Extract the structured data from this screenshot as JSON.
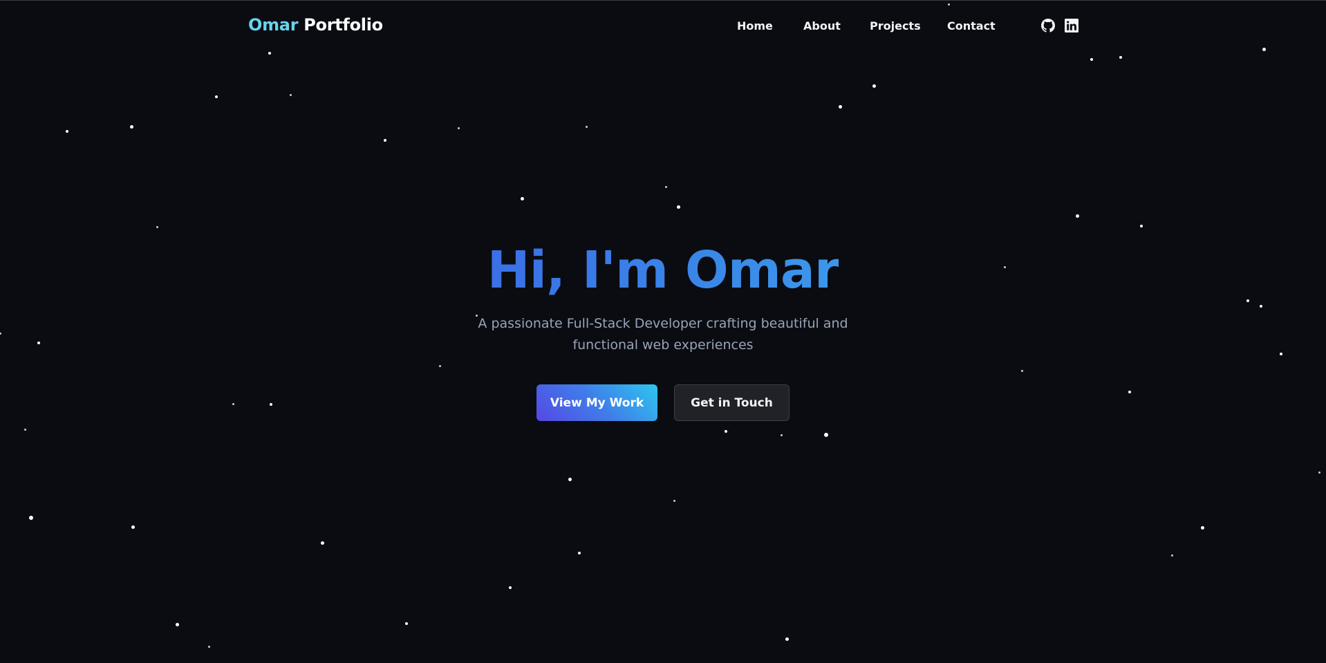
{
  "nav": {
    "logo_first": "Omar",
    "logo_second": "Portfolio",
    "links": [
      {
        "label": "Home"
      },
      {
        "label": "About"
      },
      {
        "label": "Projects"
      },
      {
        "label": "Contact"
      }
    ],
    "social": [
      {
        "icon": "github-icon"
      },
      {
        "icon": "linkedin-icon"
      }
    ]
  },
  "hero": {
    "title": "Hi, I'm Omar",
    "subtitle": "A passionate Full-Stack Developer crafting beautiful and functional web experiences",
    "primary_button": "View My Work",
    "secondary_button": "Get in Touch"
  },
  "colors": {
    "background": "#0a0c11",
    "logo_accent": "#67d4ee",
    "title_gradient_start": "#3b6fe6",
    "title_gradient_end": "#3c97ea",
    "button_gradient_start": "#5548e4",
    "button_gradient_end": "#2ec7ee",
    "subtitle": "#9aa4b8"
  }
}
